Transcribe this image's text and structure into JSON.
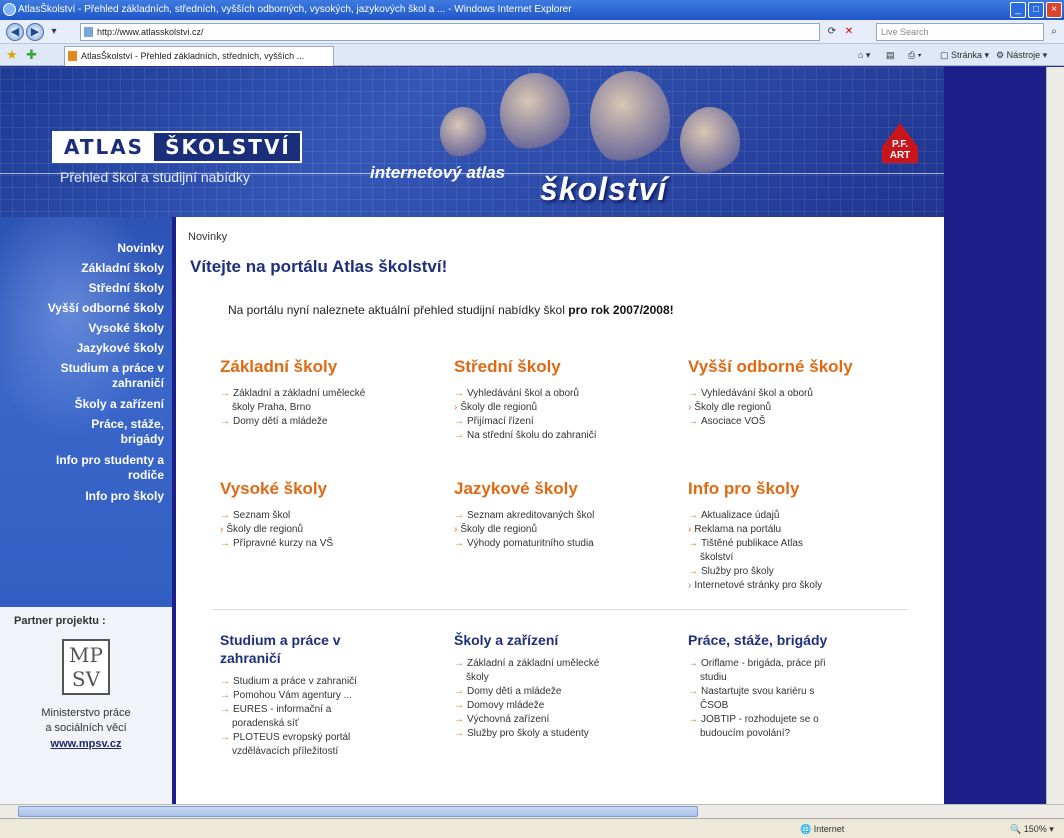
{
  "window": {
    "title": "AtlasŠkolství - Přehled základních, středních, vyšších odborných, vysokých, jazykových škol a ... - Windows Internet Explorer"
  },
  "toolbar": {
    "address": "http://www.atlasskolstvi.cz/",
    "search_placeholder": "Live Search",
    "tab_title": "AtlasŠkolství - Přehled základních, středních, vyšších ...",
    "page_menu": "Stránka",
    "tools_menu": "Nástroje"
  },
  "banner": {
    "logo_left": "ATLAS",
    "logo_right": "ŠKOLSTVÍ",
    "logo_subtitle": "Přehled škol a studijní nabídky",
    "tagline": "internetový atlas",
    "big_word": "školství",
    "brand_badge": "P.F. ART"
  },
  "nav": {
    "items": [
      "Novinky",
      "Základní školy",
      "Střední školy",
      "Vyšší odborné školy",
      "Vysoké školy",
      "Jazykové školy",
      "Studium a práce v",
      "zahraničí",
      "Školy a zařízení",
      "Práce, stáže,",
      "brigády",
      "Info pro studenty a",
      "rodiče",
      "Info pro školy"
    ]
  },
  "partner": {
    "title": "Partner projektu :",
    "logo_top": "MP",
    "logo_bottom": "SV",
    "line1": "Ministerstvo práce",
    "line2": "a sociálních věcí",
    "link": "www.mpsv.cz"
  },
  "content": {
    "breadcrumb": "Novinky",
    "welcome": "Vítejte na portálu Atlas školství!",
    "intro_text": "Na portálu nyní naleznete aktuální přehled studijní nabídky škol",
    "intro_bold": "pro rok 2007/2008!",
    "sections": [
      {
        "title": "Základní školy",
        "links": [
          "Základní a základní umělecké",
          "školy Praha, Brno",
          "Domy dětí a mládeže"
        ]
      },
      {
        "title": "Střední školy",
        "links": [
          "Vyhledávání škol a oborů",
          "Školy dle regionů",
          "Přijímací řízení",
          "Na střední školu do zahraničí"
        ]
      },
      {
        "title": "Vyšší odborné školy",
        "links": [
          "Vyhledávání škol a oborů",
          "Školy dle regionů",
          "Asociace VOŠ"
        ]
      },
      {
        "title": "Vysoké školy",
        "links": [
          "Seznam škol",
          "Školy dle regionů",
          "Přípravné kurzy na VŠ"
        ]
      },
      {
        "title": "Jazykové školy",
        "links": [
          "Seznam akreditovaných škol",
          "Školy dle regionů",
          "Výhody pomaturitního studia"
        ]
      },
      {
        "title": "Info pro školy",
        "links": [
          "Aktualizace údajů",
          "Reklama na portálu",
          "Tištěné publikace Atlas",
          "školství",
          "Služby pro školy",
          "Internetové stránky pro školy"
        ]
      },
      {
        "title": "Studium a práce v",
        "title2": "zahraničí",
        "links": [
          "Studium a práce v zahraničí",
          "Pomohou Vám agentury ...",
          "EURES - informační a",
          "poradenská síť",
          "PLOTEUS evropský portál",
          "vzdělávacích příležitostí"
        ]
      },
      {
        "title": "Školy a zařízení",
        "links": [
          "Základní a základní umělecké",
          "školy",
          "Domy dětí a mládeže",
          "Domovy mládeže",
          "Výchovná zařízení",
          "Služby pro školy a studenty"
        ]
      },
      {
        "title": "Práce, stáže, brigády",
        "links": [
          "Oriflame - brigáda, práce při",
          "studiu",
          "Nastartujte svou kariéru s",
          "ČSOB",
          "JOBTIP - rozhodujete se o",
          "budoucím povolání?"
        ]
      }
    ]
  },
  "status": {
    "zone": "Internet",
    "zoom": "150%"
  }
}
